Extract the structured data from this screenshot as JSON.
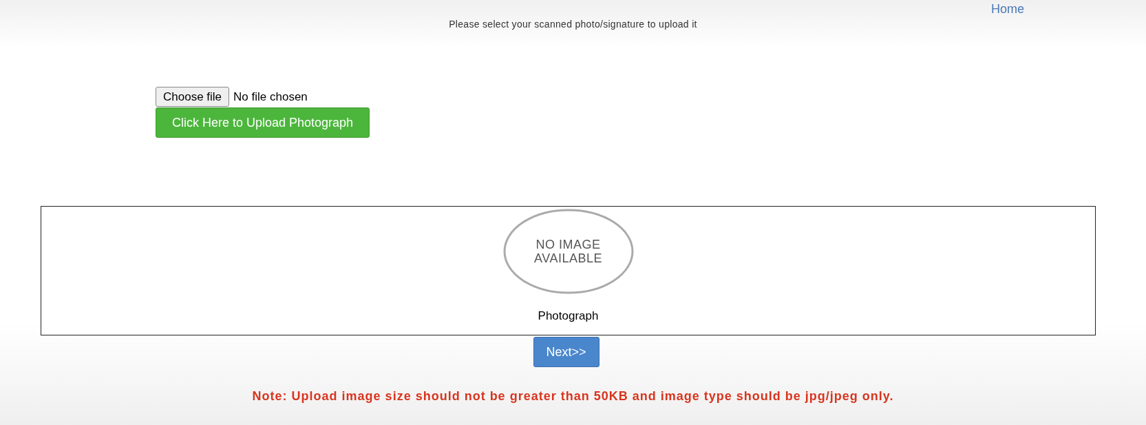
{
  "header": {
    "home_link": "Home",
    "instruction": "Please select your scanned photo/signature to upload it"
  },
  "file_input": {
    "button": "Choose file",
    "status": "No file chosen"
  },
  "upload_button": "Click Here to Upload Photograph",
  "preview": {
    "placeholder_text": "NO IMAGE AVAILABLE",
    "caption": "Photograph"
  },
  "next_button": "Next>>",
  "note": "Note: Upload image size should not be greater than 50KB and image type should be jpg/jpeg only."
}
